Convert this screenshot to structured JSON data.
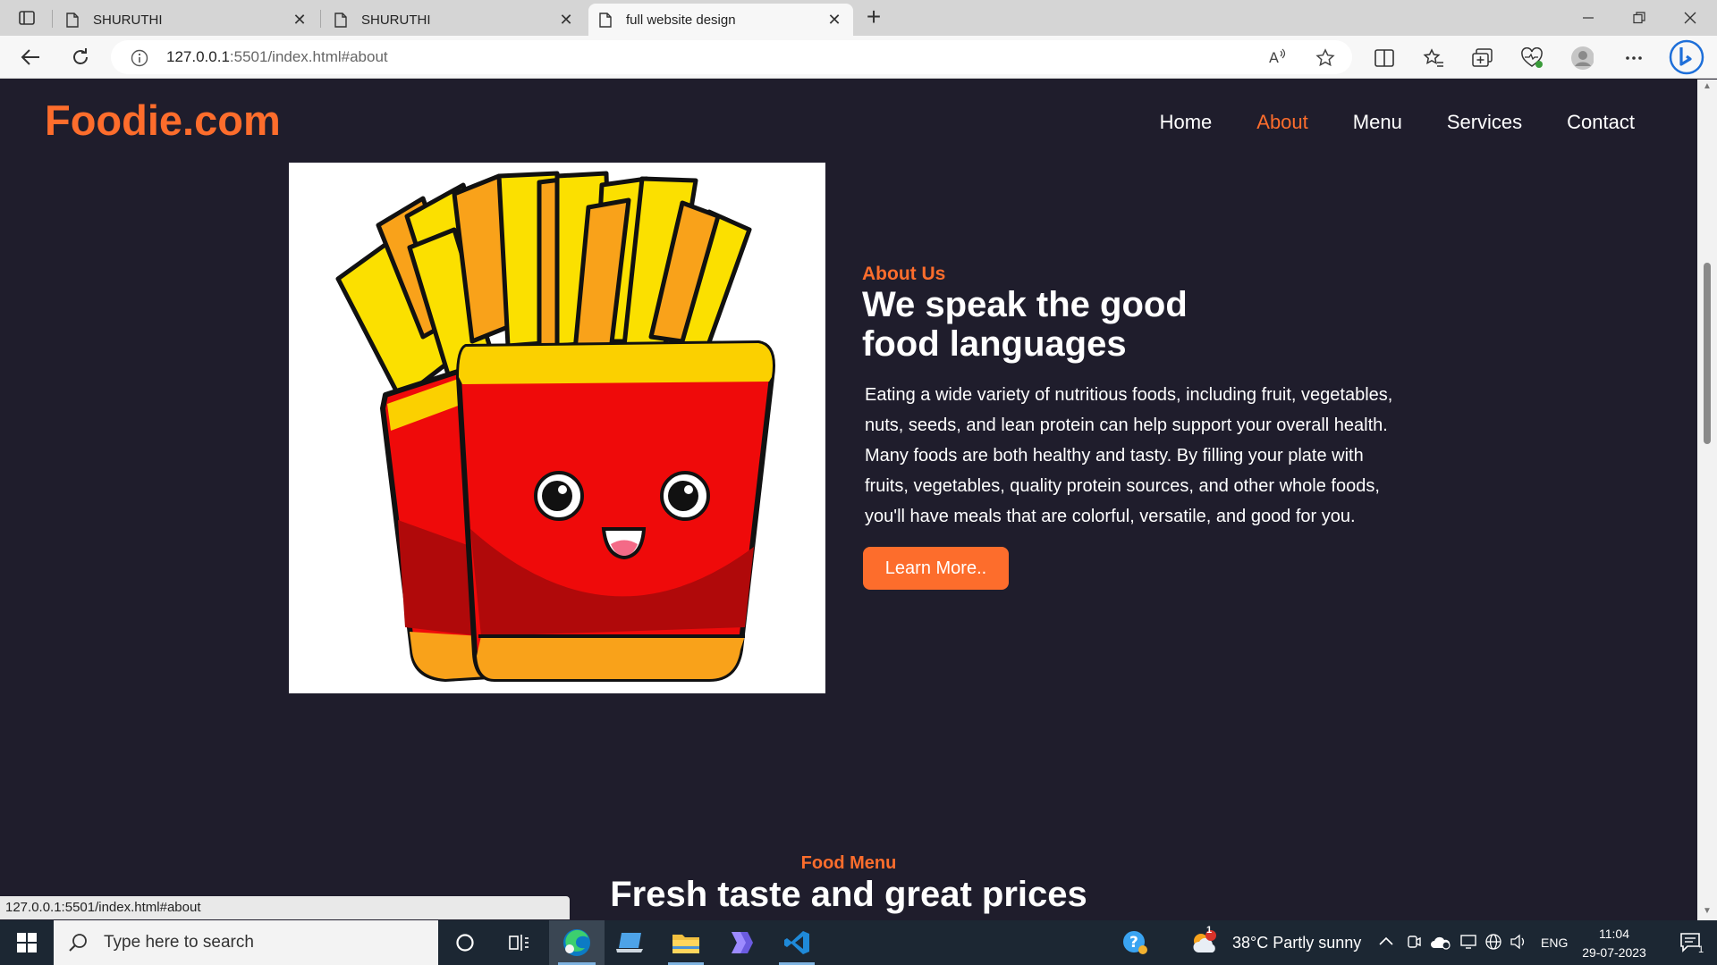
{
  "browser": {
    "tabs": [
      {
        "label": "SHURUTHI",
        "active": false
      },
      {
        "label": "SHURUTHI",
        "active": false
      },
      {
        "label": "full website design",
        "active": true
      }
    ],
    "url_host": "127.0.0.1",
    "url_rest": ":5501/index.html#about",
    "status_url": "127.0.0.1:5501/index.html#about"
  },
  "site": {
    "logo": "Foodie.com",
    "nav": [
      "Home",
      "About",
      "Menu",
      "Services",
      "Contact"
    ],
    "active_nav": "About",
    "about": {
      "tag": "About Us",
      "title": "We speak the good food languages",
      "text": "Eating a wide variety of nutritious foods, including fruit, vegetables, nuts, seeds, and lean protein can help support your overall health. Many foods are both healthy and tasty. By filling your plate with fruits, vegetables, quality protein sources, and other whole foods, you'll have meals that are colorful, versatile, and good for you.",
      "button": "Learn More.."
    },
    "menu": {
      "tag": "Food Menu",
      "title": "Fresh taste and great prices"
    },
    "colors": {
      "accent": "#fd6d2c",
      "background": "#1f1d2c"
    }
  },
  "taskbar": {
    "search_placeholder": "Type here to search",
    "weather": "38°C  Partly sunny",
    "weather_badge": "1",
    "lang": "ENG",
    "time": "11:04",
    "date": "29-07-2023",
    "notification_count": "1"
  }
}
